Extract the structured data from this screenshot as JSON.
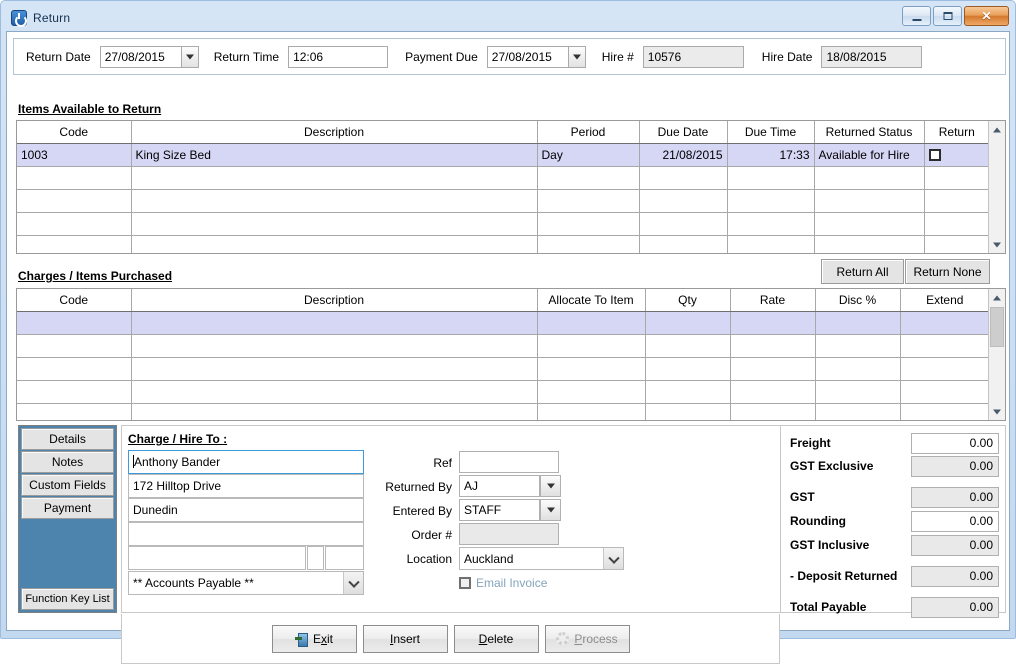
{
  "window": {
    "title": "Return",
    "icon": "power-icon",
    "buttons": {
      "minimize": "minimize-icon",
      "maximize": "maximize-icon",
      "close": "close-icon"
    }
  },
  "topbar": {
    "return_date_label": "Return Date",
    "return_date_value": "27/08/2015",
    "return_time_label": "Return Time",
    "return_time_value": "12:06",
    "payment_due_label": "Payment Due",
    "payment_due_value": "27/08/2015",
    "hire_no_label": "Hire #",
    "hire_no_value": "10576",
    "hire_date_label": "Hire Date",
    "hire_date_value": "18/08/2015"
  },
  "items_grid": {
    "title": "Items Available to Return",
    "columns": [
      "Code",
      "Description",
      "Period",
      "Due Date",
      "Due Time",
      "Returned Status",
      "Return"
    ],
    "rows": [
      {
        "code": "1003",
        "description": "King Size Bed",
        "period": "Day",
        "due_date": "21/08/2015",
        "due_time": "17:33",
        "returned_status": "Available for Hire",
        "return_checked": false,
        "selected": true
      },
      {
        "code": "",
        "description": "",
        "period": "",
        "due_date": "",
        "due_time": "",
        "returned_status": "",
        "selected": false
      },
      {
        "code": "",
        "description": "",
        "period": "",
        "due_date": "",
        "due_time": "",
        "returned_status": "",
        "selected": false
      },
      {
        "code": "",
        "description": "",
        "period": "",
        "due_date": "",
        "due_time": "",
        "returned_status": "",
        "selected": false
      },
      {
        "code": "",
        "description": "",
        "period": "",
        "due_date": "",
        "due_time": "",
        "returned_status": "",
        "selected": false
      }
    ]
  },
  "charges_grid": {
    "title": "Charges / Items Purchased",
    "return_all_label": "Return All",
    "return_none_label": "Return None",
    "columns": [
      "Code",
      "Description",
      "Allocate To Item",
      "Qty",
      "Rate",
      "Disc %",
      "Extend"
    ],
    "rows": [
      {
        "code": "",
        "description": "",
        "allocate": "",
        "qty": "",
        "rate": "",
        "disc": "",
        "extend": "",
        "selected": true
      },
      {
        "code": "",
        "description": "",
        "allocate": "",
        "qty": "",
        "rate": "",
        "disc": "",
        "extend": "",
        "selected": false
      },
      {
        "code": "",
        "description": "",
        "allocate": "",
        "qty": "",
        "rate": "",
        "disc": "",
        "extend": "",
        "selected": false
      },
      {
        "code": "",
        "description": "",
        "allocate": "",
        "qty": "",
        "rate": "",
        "disc": "",
        "extend": "",
        "selected": false
      },
      {
        "code": "",
        "description": "",
        "allocate": "",
        "qty": "",
        "rate": "",
        "disc": "",
        "extend": "",
        "selected": false
      }
    ]
  },
  "tabs": {
    "items": [
      {
        "label": "Details"
      },
      {
        "label": "Notes"
      },
      {
        "label": "Custom Fields"
      },
      {
        "label": "Payment"
      }
    ],
    "function_key_label": "Function Key List",
    "panel_color": "#4d84ad"
  },
  "charge_to": {
    "title": "Charge / Hire To :",
    "name": "Anthony Bander",
    "address1": "172 Hilltop Drive",
    "address2": "Dunedin",
    "address3": "",
    "suburb": "",
    "code": "",
    "extra": "",
    "account": "** Accounts Payable **"
  },
  "form": {
    "ref_label": "Ref",
    "ref_value": "",
    "returned_by_label": "Returned By",
    "returned_by_value": "AJ",
    "entered_by_label": "Entered By",
    "entered_by_value": "STAFF",
    "order_no_label": "Order #",
    "order_no_value": "",
    "location_label": "Location",
    "location_value": "Auckland",
    "email_invoice_label": "Email Invoice",
    "email_invoice_checked": false
  },
  "totals": {
    "rows": [
      {
        "label": "Freight",
        "value": "0.00",
        "editable": true
      },
      {
        "label": "GST Exclusive",
        "value": "0.00",
        "editable": false
      },
      {
        "label": "GST",
        "value": "0.00",
        "editable": false
      },
      {
        "label": "Rounding",
        "value": "0.00",
        "editable": true
      },
      {
        "label": "GST Inclusive",
        "value": "0.00",
        "editable": false
      },
      {
        "label": "- Deposit Returned",
        "value": "0.00",
        "editable": false
      },
      {
        "label": "Total Payable",
        "value": "0.00",
        "editable": false
      }
    ]
  },
  "actions": {
    "exit": {
      "pre": "E",
      "mn": "x",
      "post": "it"
    },
    "insert": {
      "pre": "",
      "mn": "I",
      "post": "nsert"
    },
    "delete": {
      "pre": "",
      "mn": "D",
      "post": "elete"
    },
    "process": {
      "pre": "",
      "mn": "P",
      "post": "rocess",
      "disabled": true
    }
  }
}
